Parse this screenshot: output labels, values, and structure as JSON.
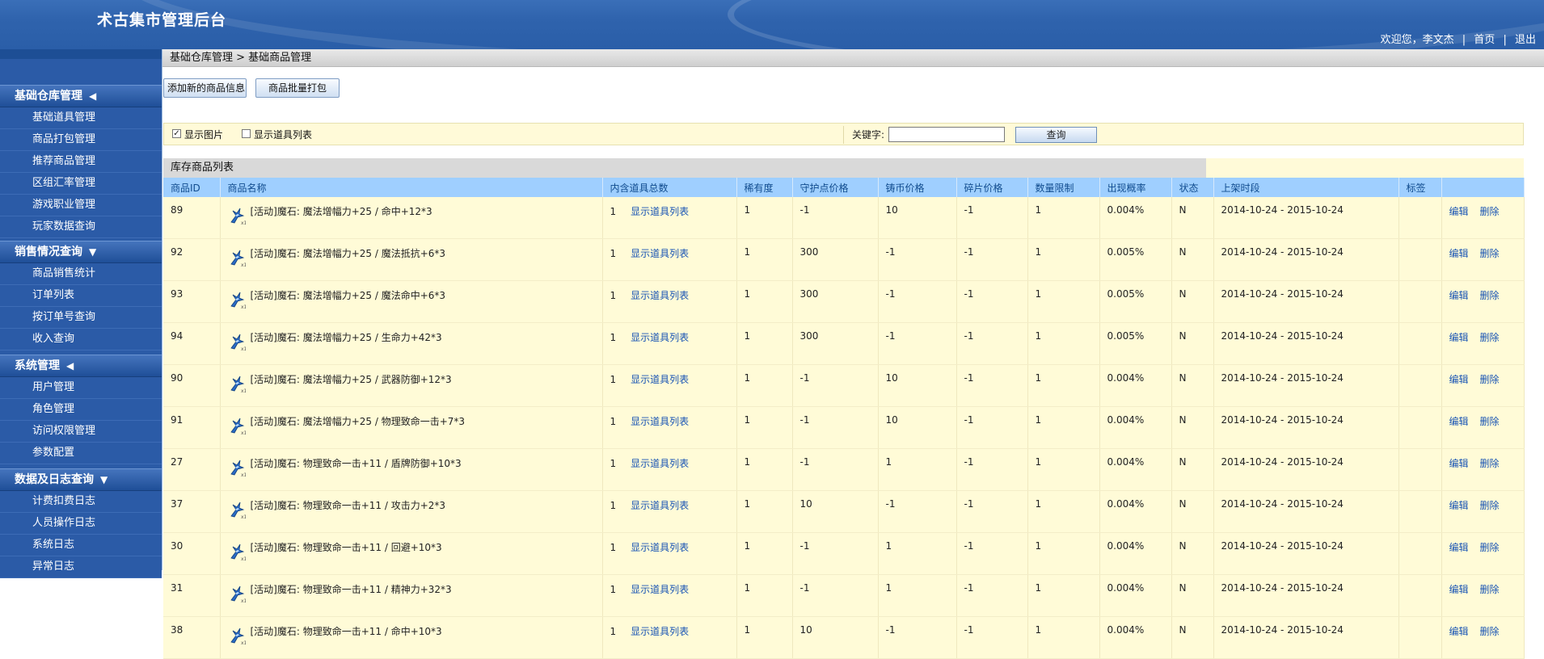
{
  "header": {
    "title": "术古集市管理后台",
    "welcome": "欢迎您，李文杰",
    "home_link": "首页",
    "logout_link": "退出",
    "separator": "|"
  },
  "sidebar": {
    "groups": [
      {
        "title": "基础仓库管理",
        "toggle": "◀",
        "items": [
          "基础道具管理",
          "商品打包管理",
          "推荐商品管理",
          "区组汇率管理",
          "游戏职业管理",
          "玩家数据查询"
        ]
      },
      {
        "title": "销售情况查询",
        "toggle": "▼",
        "items": [
          "商品销售统计",
          "订单列表",
          "按订单号查询",
          "收入查询"
        ]
      },
      {
        "title": "系统管理",
        "toggle": "◀",
        "items": [
          "用户管理",
          "角色管理",
          "访问权限管理",
          "参数配置"
        ]
      },
      {
        "title": "数据及日志查询",
        "toggle": "▼",
        "items": [
          "计费扣费日志",
          "人员操作日志",
          "系统日志",
          "异常日志"
        ]
      }
    ]
  },
  "breadcrumb": "基础仓库管理 > 基础商品管理",
  "toolbar": {
    "add_label": "添加新的商品信息",
    "bundle_label": "商品批量打包"
  },
  "filter": {
    "show_image_label": "显示图片",
    "show_image_checked": true,
    "show_items_label": "显示道具列表",
    "show_items_checked": false,
    "keyword_label": "关键字:",
    "keyword_value": "",
    "query_label": "查询"
  },
  "list": {
    "title": "库存商品列表",
    "columns": [
      "商品ID",
      "商品名称",
      "内含道具总数",
      "稀有度",
      "守护点价格",
      "铸币价格",
      "碎片价格",
      "数量限制",
      "出现概率",
      "状态",
      "上架时段",
      "标签",
      ""
    ],
    "show_items_link": "显示道具列表",
    "edit_label": "编辑",
    "delete_label": "删除",
    "rows": [
      {
        "id": "89",
        "name": "[活动]魔石: 魔法增幅力+25 / 命中+12*3",
        "count": "1",
        "rarity": "1",
        "guard_price": "-1",
        "coin_price": "10",
        "shard_price": "-1",
        "limit": "1",
        "prob": "0.004%",
        "status": "N",
        "period": "2014-10-24 - 2015-10-24",
        "tag": ""
      },
      {
        "id": "92",
        "name": "[活动]魔石: 魔法增幅力+25 / 魔法抵抗+6*3",
        "count": "1",
        "rarity": "1",
        "guard_price": "300",
        "coin_price": "-1",
        "shard_price": "-1",
        "limit": "1",
        "prob": "0.005%",
        "status": "N",
        "period": "2014-10-24 - 2015-10-24",
        "tag": ""
      },
      {
        "id": "93",
        "name": "[活动]魔石: 魔法增幅力+25 / 魔法命中+6*3",
        "count": "1",
        "rarity": "1",
        "guard_price": "300",
        "coin_price": "-1",
        "shard_price": "-1",
        "limit": "1",
        "prob": "0.005%",
        "status": "N",
        "period": "2014-10-24 - 2015-10-24",
        "tag": ""
      },
      {
        "id": "94",
        "name": "[活动]魔石: 魔法增幅力+25 / 生命力+42*3",
        "count": "1",
        "rarity": "1",
        "guard_price": "300",
        "coin_price": "-1",
        "shard_price": "-1",
        "limit": "1",
        "prob": "0.005%",
        "status": "N",
        "period": "2014-10-24 - 2015-10-24",
        "tag": ""
      },
      {
        "id": "90",
        "name": "[活动]魔石: 魔法增幅力+25 / 武器防御+12*3",
        "count": "1",
        "rarity": "1",
        "guard_price": "-1",
        "coin_price": "10",
        "shard_price": "-1",
        "limit": "1",
        "prob": "0.004%",
        "status": "N",
        "period": "2014-10-24 - 2015-10-24",
        "tag": ""
      },
      {
        "id": "91",
        "name": "[活动]魔石: 魔法增幅力+25 / 物理致命一击+7*3",
        "count": "1",
        "rarity": "1",
        "guard_price": "-1",
        "coin_price": "10",
        "shard_price": "-1",
        "limit": "1",
        "prob": "0.004%",
        "status": "N",
        "period": "2014-10-24 - 2015-10-24",
        "tag": ""
      },
      {
        "id": "27",
        "name": "[活动]魔石: 物理致命一击+11 / 盾牌防御+10*3",
        "count": "1",
        "rarity": "1",
        "guard_price": "-1",
        "coin_price": "1",
        "shard_price": "-1",
        "limit": "1",
        "prob": "0.004%",
        "status": "N",
        "period": "2014-10-24 - 2015-10-24",
        "tag": ""
      },
      {
        "id": "37",
        "name": "[活动]魔石: 物理致命一击+11 / 攻击力+2*3",
        "count": "1",
        "rarity": "1",
        "guard_price": "10",
        "coin_price": "-1",
        "shard_price": "-1",
        "limit": "1",
        "prob": "0.004%",
        "status": "N",
        "period": "2014-10-24 - 2015-10-24",
        "tag": ""
      },
      {
        "id": "30",
        "name": "[活动]魔石: 物理致命一击+11 / 回避+10*3",
        "count": "1",
        "rarity": "1",
        "guard_price": "-1",
        "coin_price": "1",
        "shard_price": "-1",
        "limit": "1",
        "prob": "0.004%",
        "status": "N",
        "period": "2014-10-24 - 2015-10-24",
        "tag": ""
      },
      {
        "id": "31",
        "name": "[活动]魔石: 物理致命一击+11 / 精神力+32*3",
        "count": "1",
        "rarity": "1",
        "guard_price": "-1",
        "coin_price": "1",
        "shard_price": "-1",
        "limit": "1",
        "prob": "0.004%",
        "status": "N",
        "period": "2014-10-24 - 2015-10-24",
        "tag": ""
      },
      {
        "id": "38",
        "name": "[活动]魔石: 物理致命一击+11 / 命中+10*3",
        "count": "1",
        "rarity": "1",
        "guard_price": "10",
        "coin_price": "-1",
        "shard_price": "-1",
        "limit": "1",
        "prob": "0.004%",
        "status": "N",
        "period": "2014-10-24 - 2015-10-24",
        "tag": ""
      }
    ]
  },
  "colors": {
    "header_blue": "#2f63ad",
    "sidebar_blue": "#2b5ba7",
    "table_header": "#9fcfff",
    "row_yellow": "#fffbd7",
    "link_blue": "#1a55b4"
  }
}
